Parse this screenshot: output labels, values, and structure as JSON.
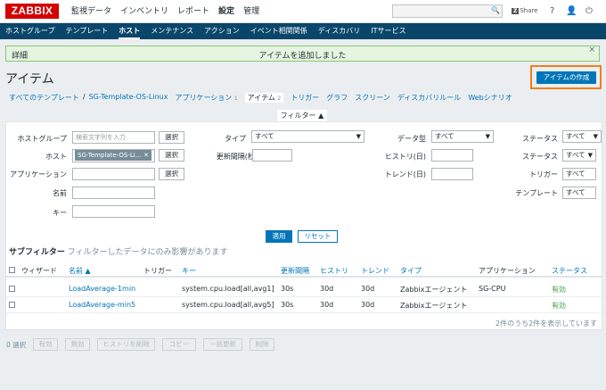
{
  "header": {
    "logo": "ZABBIX",
    "menu": [
      "監視データ",
      "インベントリ",
      "レポート",
      "設定",
      "管理"
    ],
    "search_button": "🔍",
    "share": "Share",
    "share_badge": "Z",
    "help": "?",
    "user": "👤",
    "logout": "⏻"
  },
  "subnav": [
    "ホストグループ",
    "テンプレート",
    "ホスト",
    "メンテナンス",
    "アクション",
    "イベント相関関係",
    "ディスカバリ",
    "ITサービス"
  ],
  "message": {
    "details": "詳細",
    "text": "アイテムを追加しました",
    "close": "×"
  },
  "page": {
    "title": "アイテム",
    "create_button": "アイテムの作成"
  },
  "breadcrumb": {
    "all_templates": "すべてのテンプレート",
    "separator": "/",
    "template": "SG-Template-OS-Linux",
    "applications": "アプリケーション",
    "applications_count": "1",
    "items": "アイテム",
    "items_count": "2",
    "triggers": "トリガー",
    "graphs": "グラフ",
    "screens": "スクリーン",
    "discovery": "ディスカバリルール",
    "web": "Webシナリオ"
  },
  "filter": {
    "tab": "フィルター ▲",
    "hostgroup_label": "ホストグループ",
    "hostgroup_placeholder": "検索文字列を入力",
    "select": "選択",
    "host_label": "ホスト",
    "host_chip": "SG-Template-OS-Li...",
    "chip_close": "✕",
    "application_label": "アプリケーション",
    "name_label": "名前",
    "key_label": "キー",
    "type_label": "タイプ",
    "type_value": "すべて",
    "interval_label": "更新間隔(秒)",
    "datatype_label": "データ型",
    "datatype_value": "すべて",
    "history_label": "ヒストリ(日)",
    "trends_label": "トレンド(日)",
    "status1_label": "ステータス",
    "status1_value": "すべて",
    "status2_label": "ステータス",
    "status2_value": "すべて",
    "trigger_label": "トリガー",
    "trigger_value": "すべて",
    "template_label": "テンプレート",
    "template_value": "すべて",
    "apply": "適用",
    "reset": "リセット"
  },
  "subfilter": {
    "title": "サブフィルター",
    "desc": "フィルターしたデータにのみ影響があります"
  },
  "table": {
    "headers": {
      "wizard": "ウィザード",
      "name": "名前 ▲",
      "triggers": "トリガー",
      "key": "キー",
      "interval": "更新間隔",
      "history": "ヒストリ",
      "trends": "トレンド",
      "type": "タイプ",
      "application": "アプリケーション",
      "status": "ステータス"
    },
    "rows": [
      {
        "name": "LoadAverage-1min",
        "key": "system.cpu.load[all,avg1]",
        "interval": "30s",
        "history": "30d",
        "trends": "30d",
        "type": "Zabbixエージェント",
        "application": "SG-CPU",
        "status": "有効"
      },
      {
        "name": "LoadAverage-min5",
        "key": "system.cpu.load[all,avg5]",
        "interval": "30s",
        "history": "30d",
        "trends": "30d",
        "type": "Zabbixエージェント",
        "application": "",
        "status": "有効"
      }
    ],
    "count": "2件のうち2件を表示しています"
  },
  "bulk": {
    "selected": "0 選択",
    "enable": "有効",
    "disable": "無効",
    "clear_history": "ヒストリを削除",
    "copy": "コピー",
    "mass_update": "一括更新",
    "delete": "削除"
  }
}
